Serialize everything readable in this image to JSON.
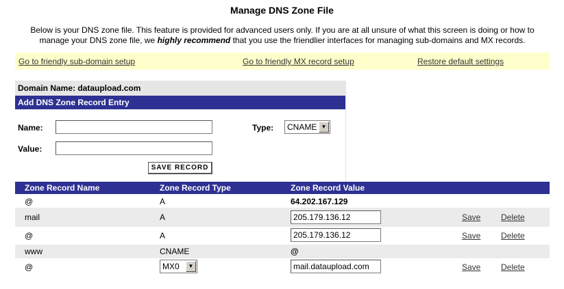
{
  "page": {
    "title": "Manage DNS Zone File",
    "intro_part1": "Below is your DNS zone file. This feature is provided for advanced users only. If you are at all unsure of what this screen is doing or how to manage your DNS zone file, we ",
    "intro_emphasis": "highly recommend",
    "intro_part2": " that you use the friendlier interfaces for managing sub-domains and MX records."
  },
  "links": {
    "subdomain": "Go to friendly sub-domain setup",
    "mx": "Go to friendly MX record setup",
    "restore": "Restore default settings"
  },
  "domain_label": "Domain Name: dataupload.com",
  "add_form": {
    "header": "Add DNS Zone Record Entry",
    "name_label": "Name:",
    "name_value": "",
    "value_label": "Value:",
    "value_value": "",
    "type_label": "Type:",
    "type_selected": "CNAME",
    "save_label": "SAVE RECORD"
  },
  "table": {
    "headers": [
      "Zone Record Name",
      "Zone Record Type",
      "Zone Record Value"
    ],
    "rows": [
      {
        "name": "@",
        "type": "A",
        "value": "64.202.167.129",
        "editable": false
      },
      {
        "name": "mail",
        "type": "A",
        "value": "205.179.136.12",
        "editable": true,
        "save": "Save",
        "delete": "Delete"
      },
      {
        "name": "@",
        "type": "A",
        "value": "205.179.136.12",
        "editable": true,
        "save": "Save",
        "delete": "Delete"
      },
      {
        "name": "www",
        "type": "CNAME",
        "value": "@",
        "editable": false
      },
      {
        "name": "@",
        "type": "MX0",
        "value": "mail.dataupload.com",
        "editable": true,
        "save": "Save",
        "delete": "Delete"
      }
    ]
  },
  "colors": {
    "header_bg": "#2e3192",
    "link_bar_bg": "#ffffcc",
    "domain_bg": "#e6e6e6",
    "alt_row_bg": "#ebebeb"
  }
}
